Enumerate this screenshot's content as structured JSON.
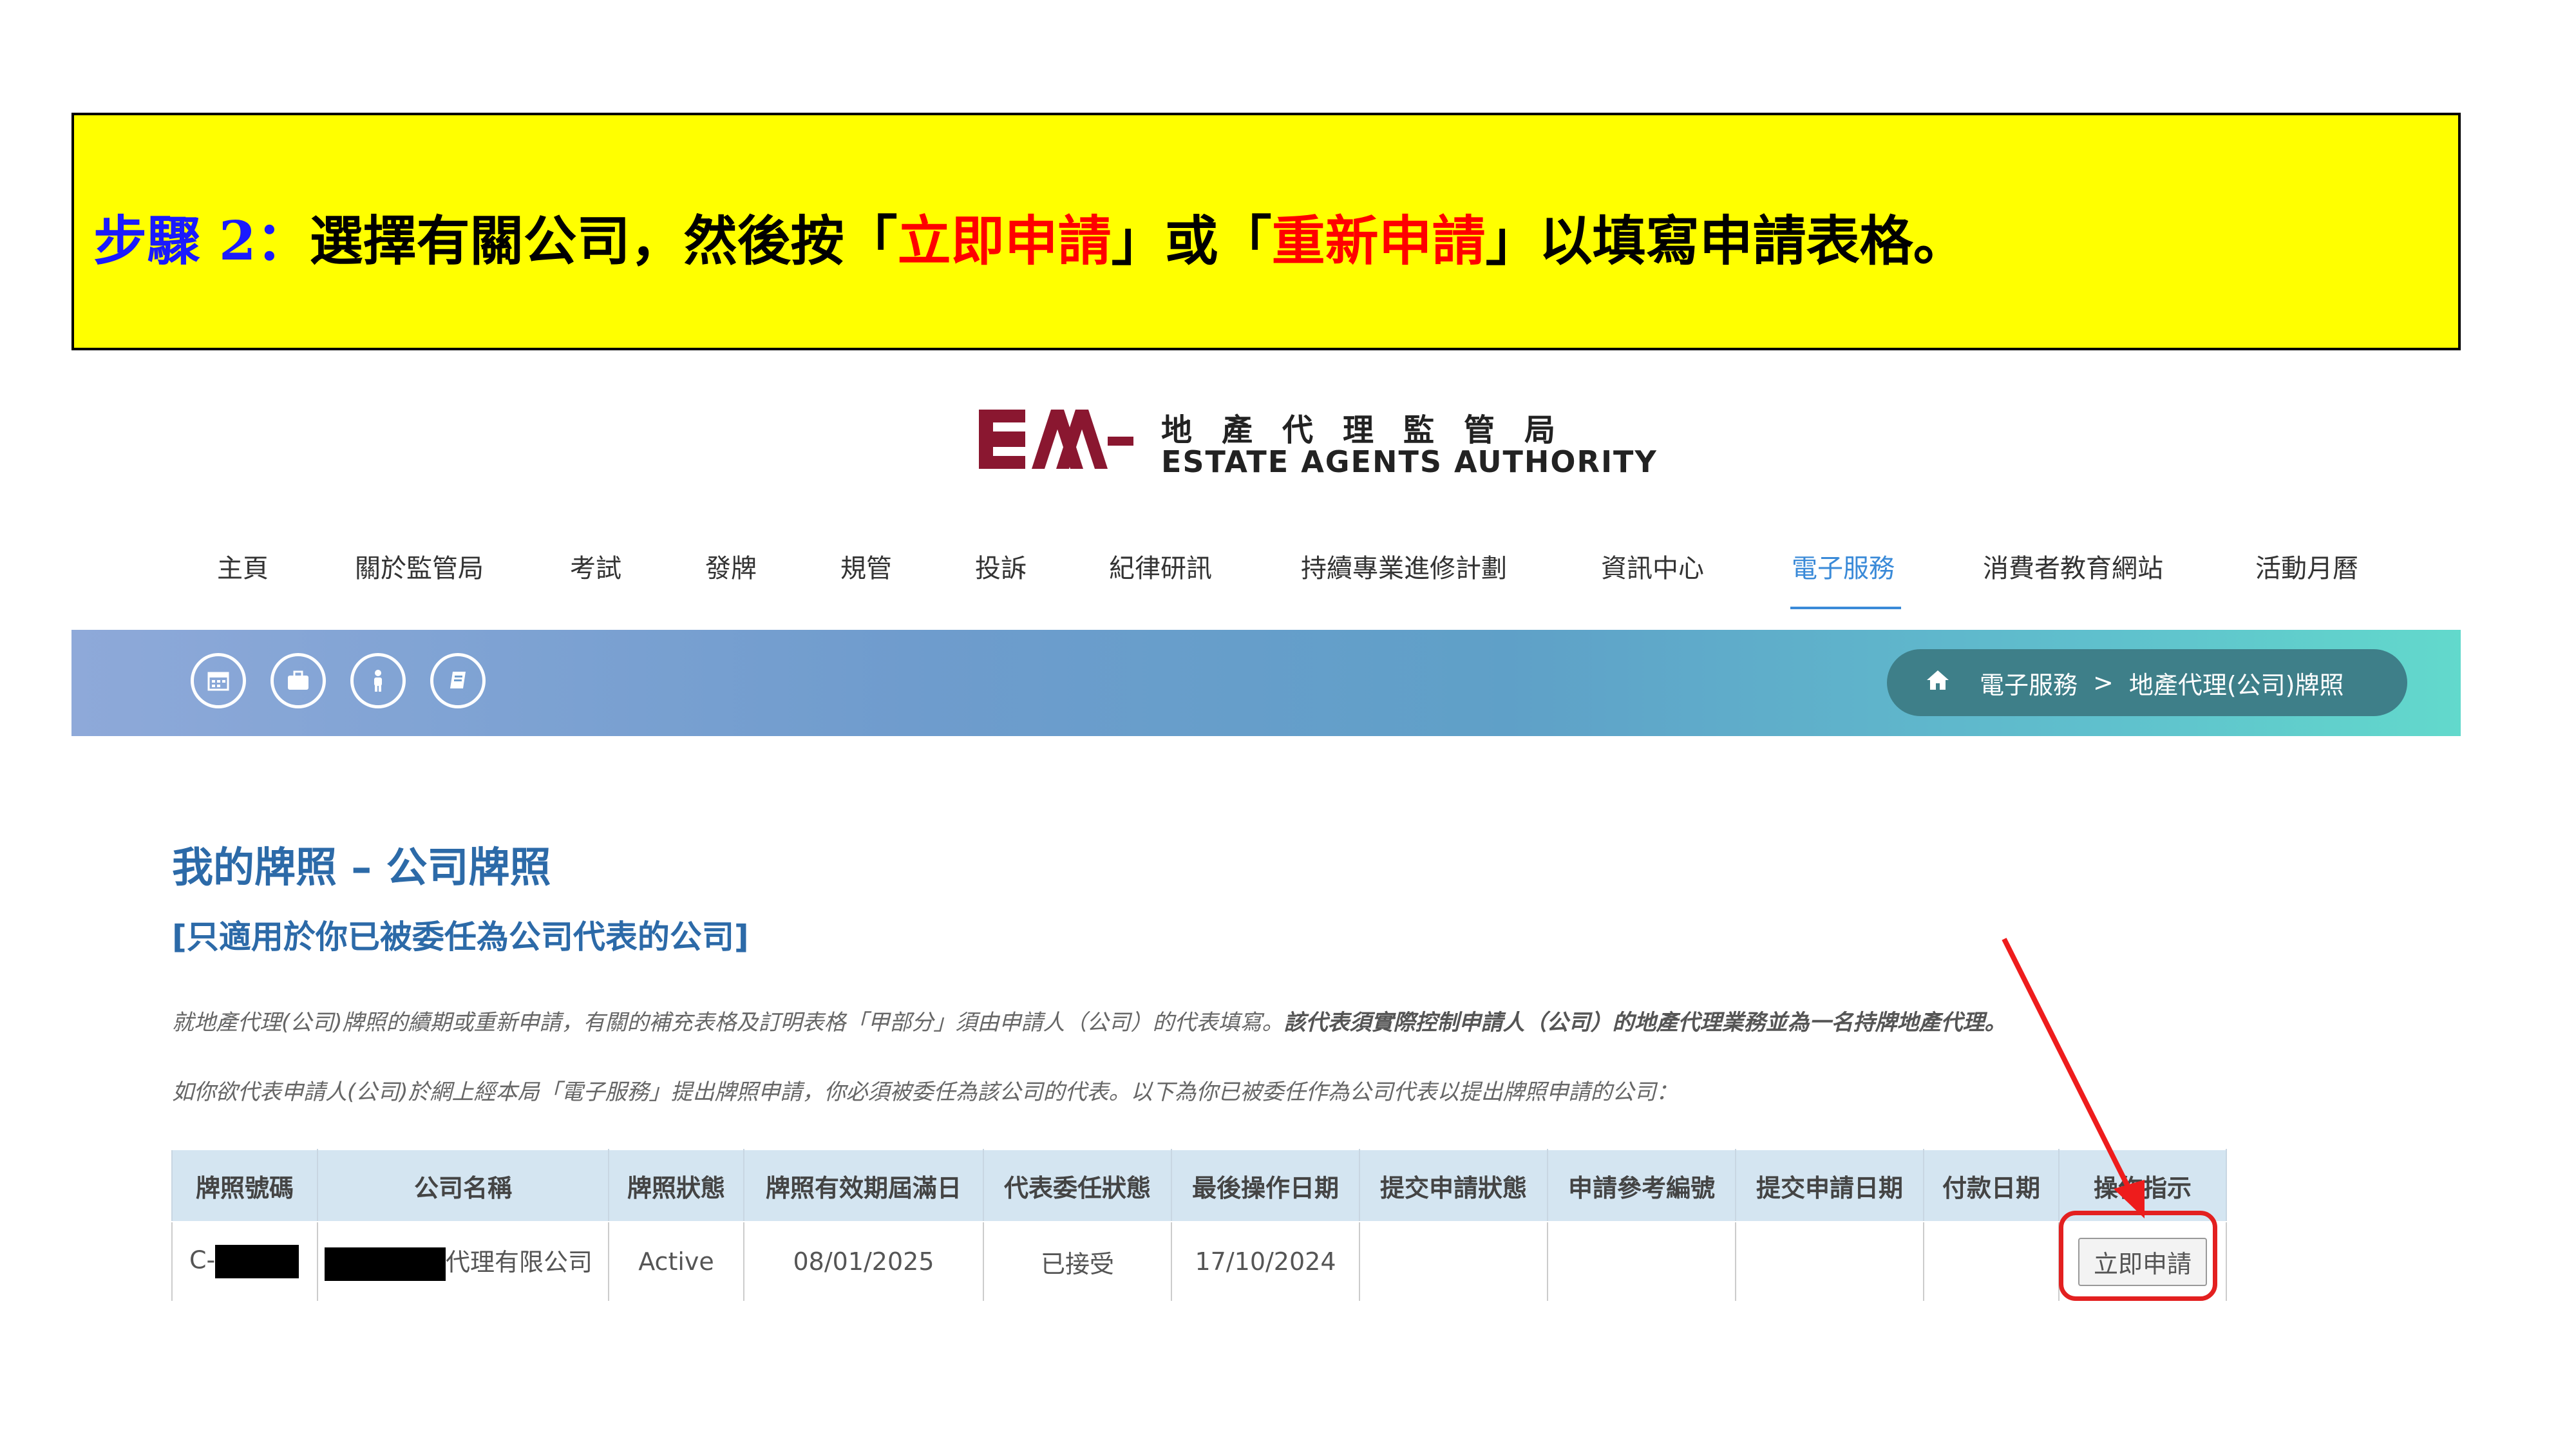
{
  "step": {
    "label": "步驟 2：",
    "text_a": "選擇有關公司，然後按「",
    "btn1": "立即申請",
    "text_b": "」或「",
    "btn2": "重新申請",
    "text_c": "」以填寫申請表格。"
  },
  "logo": {
    "mark": "EAA",
    "zh": "地產代理監管局",
    "en": "ESTATE AGENTS AUTHORITY"
  },
  "nav": [
    "主頁",
    "關於監管局",
    "考試",
    "發牌",
    "規管",
    "投訴",
    "紀律研訊",
    "持續專業進修計劃",
    "資訊中心",
    "電子服務",
    "消費者教育網站",
    "活動月曆"
  ],
  "hero": {
    "icons": [
      "calendar-icon",
      "briefcase-icon",
      "person-icon",
      "book-icon"
    ],
    "breadcrumb": {
      "level1": "電子服務",
      "sep": ">",
      "level2": "地產代理(公司)牌照"
    }
  },
  "page": {
    "title": "我的牌照 – 公司牌照",
    "subtitle": "[只適用於你已被委任為公司代表的公司]",
    "para1_normal": "就地產代理(公司)牌照的續期或重新申請，有關的補充表格及訂明表格「甲部分」須由申請人（公司）的代表填寫。",
    "para1_bold": "該代表須實際控制申請人（公司）的地產代理業務並為一名持牌地產代理。",
    "para2": "如你欲代表申請人(公司)於網上經本局「電子服務」提出牌照申請，你必須被委任為該公司的代表。以下為你已被委任作為公司代表以提出牌照申請的公司："
  },
  "table": {
    "headers": [
      "牌照號碼",
      "公司名稱",
      "牌照狀態",
      "牌照有效期屆滿日",
      "代表委任狀態",
      "最後操作日期",
      "提交申請狀態",
      "申請參考編號",
      "提交申請日期",
      "付款日期",
      "操作指示"
    ],
    "row": {
      "license_prefix": "C-",
      "company_suffix": "代理有限公司",
      "status": "Active",
      "expiry": "08/01/2025",
      "appointment": "已接受",
      "last_action": "17/10/2024",
      "submit_status": "",
      "ref_no": "",
      "submit_date": "",
      "pay_date": "",
      "action_label": "立即申請"
    }
  },
  "colors": {
    "banner": "#ffff00",
    "accent": "#3a8ad8",
    "title": "#2c6aa8",
    "highlight": "#e32020"
  }
}
